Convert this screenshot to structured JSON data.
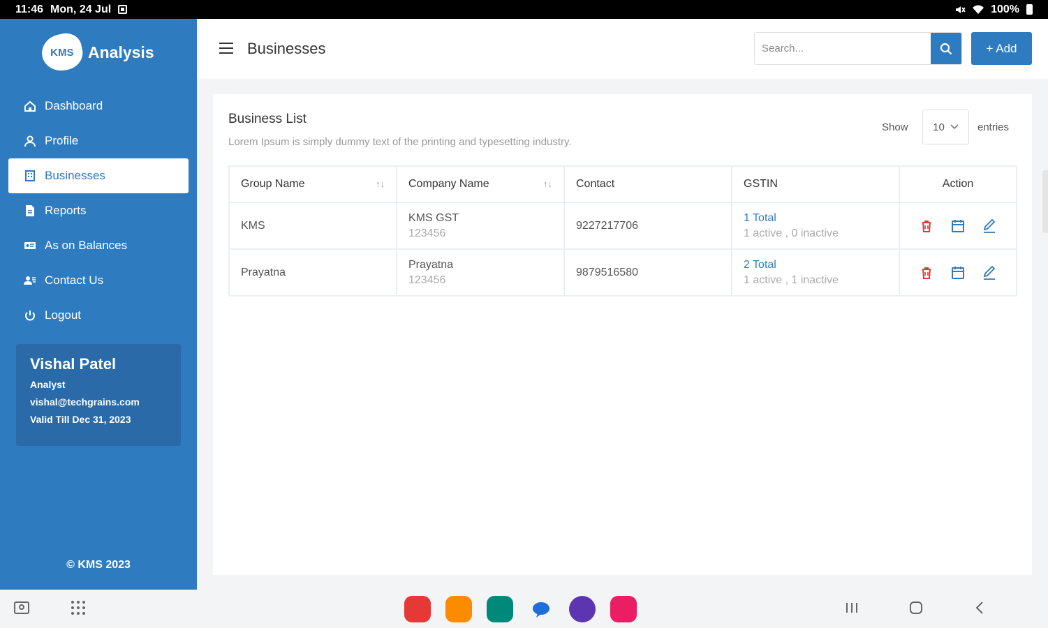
{
  "status_bar": {
    "time": "11:46",
    "date": "Mon, 24 Jul",
    "battery": "100%"
  },
  "sidebar": {
    "logo_mark": "KMS",
    "logo_text": "Analysis",
    "items": [
      {
        "label": "Dashboard",
        "icon": "home-icon"
      },
      {
        "label": "Profile",
        "icon": "person-icon"
      },
      {
        "label": "Businesses",
        "icon": "building-icon",
        "active": true
      },
      {
        "label": "Reports",
        "icon": "document-icon"
      },
      {
        "label": "As on Balances",
        "icon": "id-card-icon"
      },
      {
        "label": "Contact Us",
        "icon": "contacts-icon"
      },
      {
        "label": "Logout",
        "icon": "power-icon"
      }
    ],
    "user": {
      "name": "Vishal Patel",
      "role": "Analyst",
      "email": "vishal@techgrains.com",
      "valid": "Valid Till  Dec 31, 2023"
    },
    "footer": "© KMS 2023"
  },
  "header": {
    "title": "Businesses",
    "search_placeholder": "Search...",
    "add_label": "+ Add"
  },
  "card": {
    "title": "Business List",
    "subtitle": "Lorem Ipsum is simply dummy text of the printing and typesetting industry.",
    "show_label": "Show",
    "entries_value": "10",
    "entries_label": "entries",
    "columns": [
      "Group Name",
      "Company Name",
      "Contact",
      "GSTIN",
      "Action"
    ],
    "sort_glyph": "↑↓",
    "rows": [
      {
        "group": "KMS",
        "company": "KMS GST",
        "company_code": "123456",
        "contact": "9227217706",
        "gstin_total": "1 Total",
        "gstin_status": "1 active , 0 inactive"
      },
      {
        "group": "Prayatna",
        "company": "Prayatna",
        "company_code": "123456",
        "contact": "9879516580",
        "gstin_total": "2 Total",
        "gstin_status": "1 active , 1 inactive"
      }
    ]
  },
  "colors": {
    "primary": "#2f7bbf",
    "danger": "#e53935",
    "status_bar": "#000000"
  }
}
